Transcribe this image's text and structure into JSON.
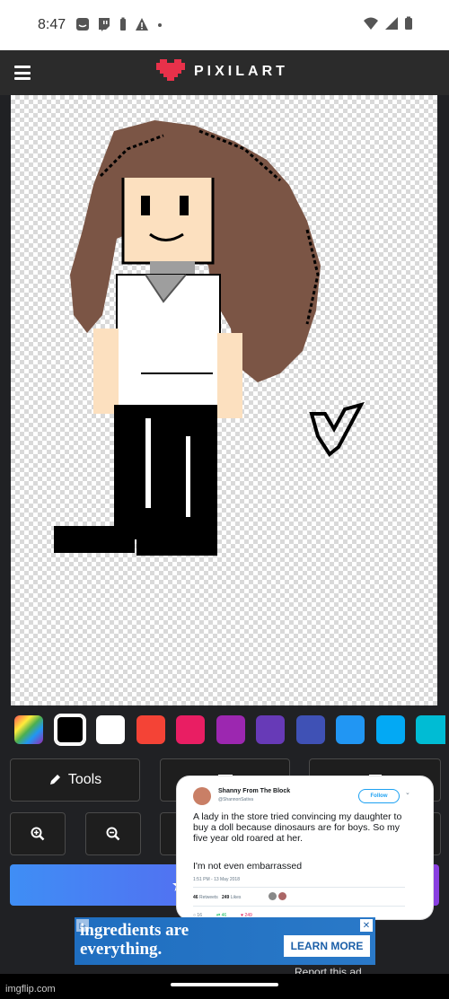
{
  "status_bar": {
    "time": "8:47"
  },
  "app": {
    "logo_text": "PIXILART",
    "brand_color": "#e8314a"
  },
  "palette": [
    {
      "name": "rainbow",
      "color": "rainbow"
    },
    {
      "name": "black",
      "color": "#000000",
      "selected": true
    },
    {
      "name": "white",
      "color": "#ffffff"
    },
    {
      "name": "red",
      "color": "#f44336"
    },
    {
      "name": "pink",
      "color": "#e91e63"
    },
    {
      "name": "purple",
      "color": "#9c27b0"
    },
    {
      "name": "deep-purple",
      "color": "#673ab7"
    },
    {
      "name": "indigo",
      "color": "#3f51b5"
    },
    {
      "name": "blue",
      "color": "#2196f3"
    },
    {
      "name": "light-blue",
      "color": "#03a9f4"
    },
    {
      "name": "cyan",
      "color": "#00bcd4"
    }
  ],
  "toolbar": {
    "tools_label": "Tools"
  },
  "tweet": {
    "name": "Shanny From The Block",
    "handle": "@ShannonSativa",
    "follow": "Follow",
    "text": "A lady in the store tried convincing my daughter to buy a doll because dinosaurs are for boys. So my five year old roared at her.",
    "text2": "I'm not even embarrassed",
    "time": "1:51 PM - 13 May 2018",
    "retweets": "46",
    "retweets_label": "Retweets",
    "likes": "249",
    "likes_label": "Likes",
    "reply_count": "16",
    "retweet_count": "46",
    "like_count": "249"
  },
  "ad": {
    "headline": "ingredients are everything.",
    "cta": "LEARN MORE",
    "report": "Report this ad"
  },
  "watermark": "imgflip.com"
}
